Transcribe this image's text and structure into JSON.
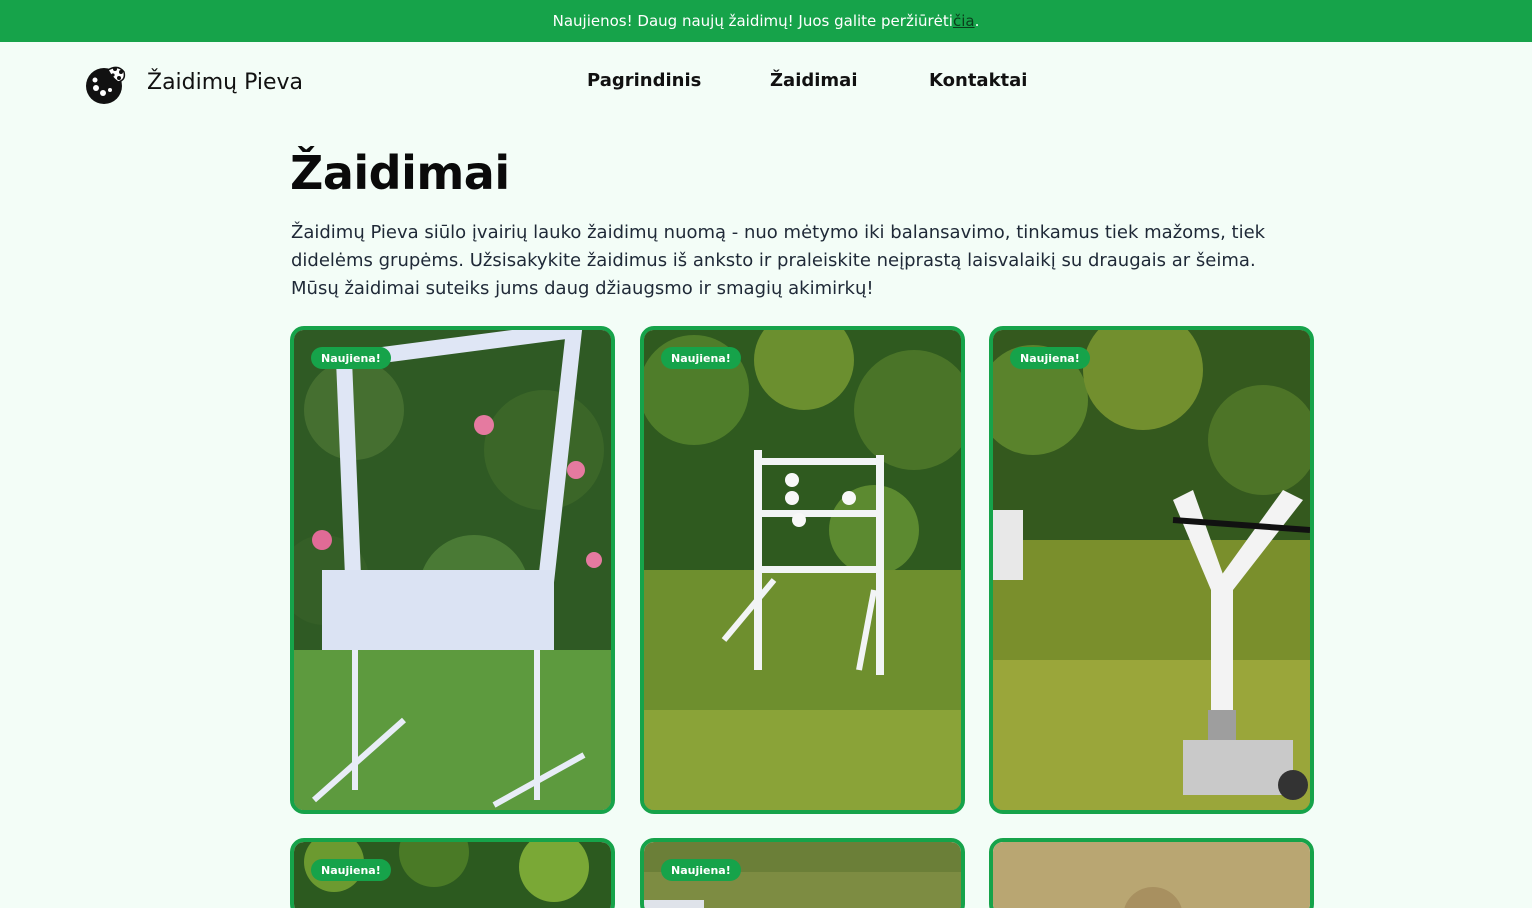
{
  "announcement": {
    "text": "Naujienos! Daug naujų žaidimų! Juos galite peržiūrėti ",
    "link_label": "čia",
    "suffix": "."
  },
  "header": {
    "brand": "Žaidimų Pieva",
    "logo_icon": "ball-icon",
    "nav": [
      "Pagrindinis",
      "Žaidimai",
      "Kontaktai"
    ]
  },
  "main": {
    "title": "Žaidimai",
    "intro": "Žaidimų Pieva siūlo įvairių lauko žaidimų nuomą - nuo mėtymo iki balansavimo, tinkamus tiek mažoms, tiek didelėms grupėms. Užsisakykite žaidimus iš anksto ir praleiskite neįprastą laisvalaikį su draugais ar šeima. Mūsų žaidimai suteiks jums daug džiaugsmo ir smagių akimirkų!",
    "cards": [
      {
        "badge": "Naujiena!"
      },
      {
        "badge": "Naujiena!"
      },
      {
        "badge": "Naujiena!"
      },
      {
        "badge": "Naujiena!"
      },
      {
        "badge": "Naujiena!"
      },
      {
        "badge": ""
      }
    ]
  },
  "colors": {
    "brand_green": "#16a34a",
    "page_background": "#f3fdf7"
  }
}
